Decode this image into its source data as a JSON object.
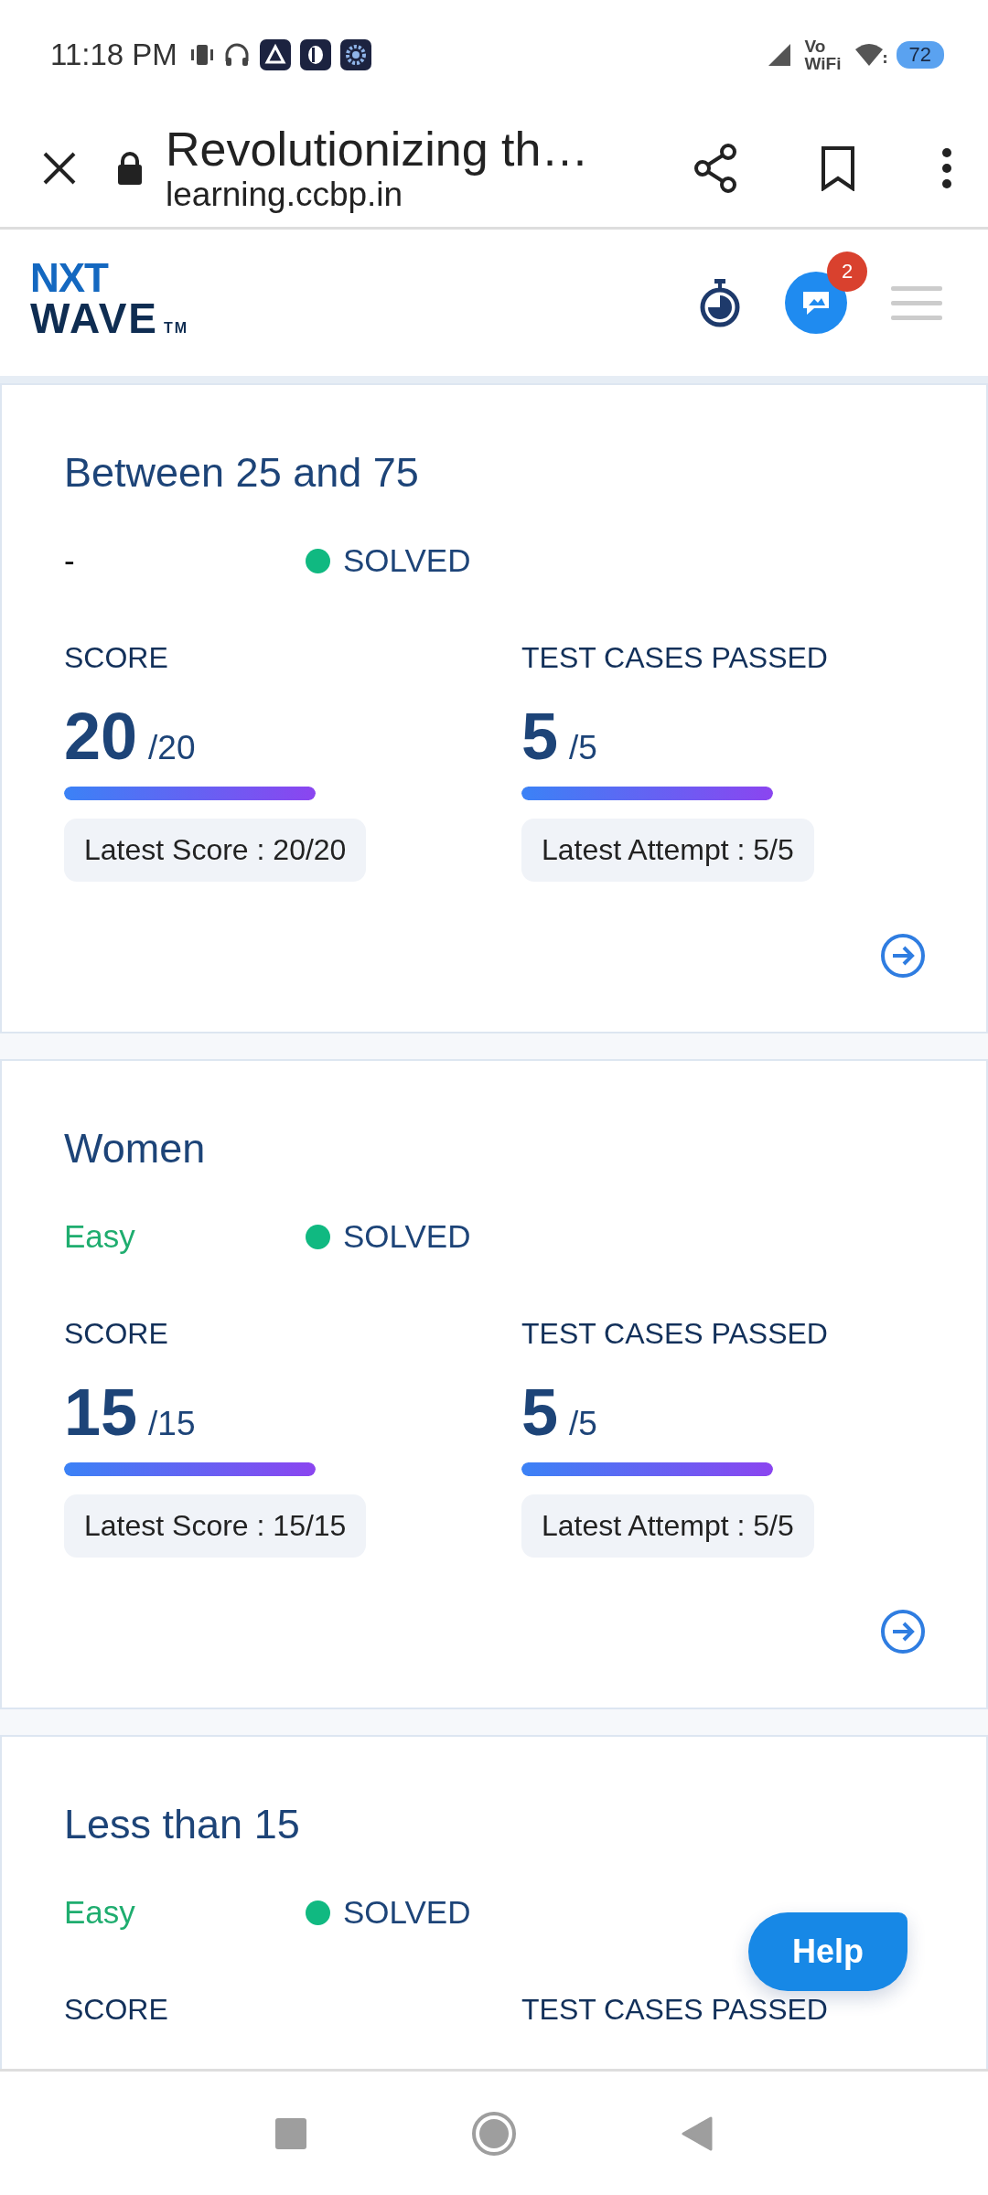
{
  "status_bar": {
    "time": "11:18 PM",
    "network_label_top": "Vo",
    "network_label_bottom": "WiFi",
    "battery": "72"
  },
  "browser_bar": {
    "title": "Revolutionizing th…",
    "url": "learning.ccbp.in"
  },
  "app_header": {
    "logo": {
      "line1": "NXT",
      "line2": "WAVE",
      "mark": "TM"
    },
    "notification_count": "2"
  },
  "cards": [
    {
      "title": "Between 25 and 75",
      "difficulty": {
        "label": "-",
        "color": "#000000"
      },
      "status": {
        "label": "SOLVED",
        "color": "#10b981"
      },
      "score": {
        "label": "SCORE",
        "value": "20",
        "total": "/20",
        "level": 1,
        "latest": "Latest Score : 20/20"
      },
      "tests": {
        "label": "TEST CASES PASSED",
        "value": "5",
        "total": "/5",
        "level": 1,
        "latest": "Latest Attempt : 5/5"
      }
    },
    {
      "title": "Women",
      "difficulty": {
        "label": "Easy",
        "color": "#1fad6f"
      },
      "status": {
        "label": "SOLVED",
        "color": "#10b981"
      },
      "score": {
        "label": "SCORE",
        "value": "15",
        "total": "/15",
        "level": 1,
        "latest": "Latest Score : 15/15"
      },
      "tests": {
        "label": "TEST CASES PASSED",
        "value": "5",
        "total": "/5",
        "level": 1,
        "latest": "Latest Attempt : 5/5"
      }
    },
    {
      "title": "Less than 15",
      "difficulty": {
        "label": "Easy",
        "color": "#1fad6f"
      },
      "status": {
        "label": "SOLVED",
        "color": "#10b981"
      },
      "score": {
        "label": "SCORE"
      },
      "tests": {
        "label": "TEST CASES PASSED"
      }
    }
  ],
  "help_button": {
    "label": "Help"
  }
}
